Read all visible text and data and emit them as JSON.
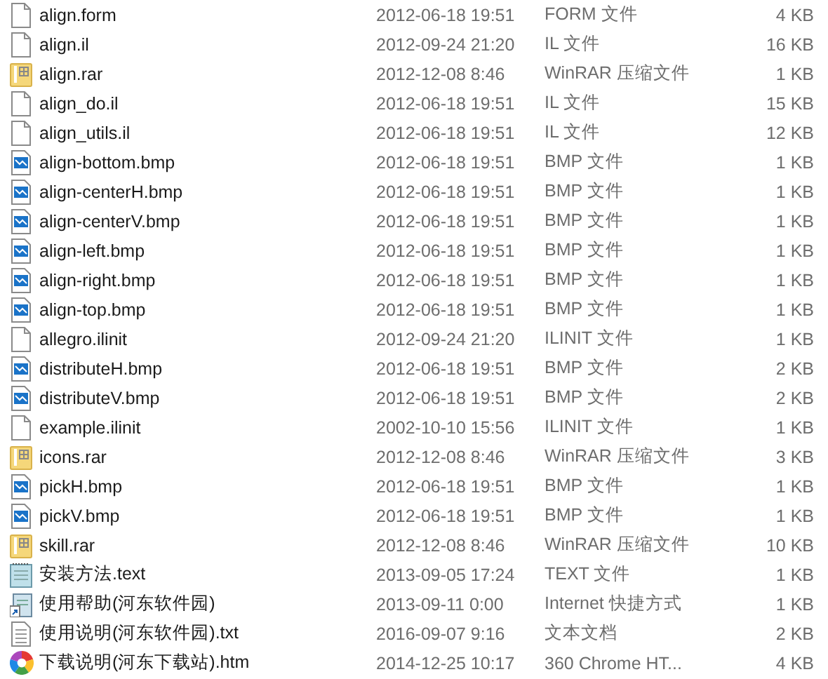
{
  "files": [
    {
      "name": "align.form",
      "kind": "blank",
      "date": "2012-06-18 19:51",
      "type": "FORM 文件",
      "size": "4 KB"
    },
    {
      "name": "align.il",
      "kind": "blank",
      "date": "2012-09-24 21:20",
      "type": "IL 文件",
      "size": "16 KB"
    },
    {
      "name": "align.rar",
      "kind": "rar",
      "date": "2012-12-08 8:46",
      "type": "WinRAR 压缩文件",
      "size": "1 KB"
    },
    {
      "name": "align_do.il",
      "kind": "blank",
      "date": "2012-06-18 19:51",
      "type": "IL 文件",
      "size": "15 KB"
    },
    {
      "name": "align_utils.il",
      "kind": "blank",
      "date": "2012-06-18 19:51",
      "type": "IL 文件",
      "size": "12 KB"
    },
    {
      "name": "align-bottom.bmp",
      "kind": "bmp",
      "date": "2012-06-18 19:51",
      "type": "BMP 文件",
      "size": "1 KB"
    },
    {
      "name": "align-centerH.bmp",
      "kind": "bmp",
      "date": "2012-06-18 19:51",
      "type": "BMP 文件",
      "size": "1 KB"
    },
    {
      "name": "align-centerV.bmp",
      "kind": "bmp",
      "date": "2012-06-18 19:51",
      "type": "BMP 文件",
      "size": "1 KB"
    },
    {
      "name": "align-left.bmp",
      "kind": "bmp",
      "date": "2012-06-18 19:51",
      "type": "BMP 文件",
      "size": "1 KB"
    },
    {
      "name": "align-right.bmp",
      "kind": "bmp",
      "date": "2012-06-18 19:51",
      "type": "BMP 文件",
      "size": "1 KB"
    },
    {
      "name": "align-top.bmp",
      "kind": "bmp",
      "date": "2012-06-18 19:51",
      "type": "BMP 文件",
      "size": "1 KB"
    },
    {
      "name": "allegro.ilinit",
      "kind": "blank",
      "date": "2012-09-24 21:20",
      "type": "ILINIT 文件",
      "size": "1 KB"
    },
    {
      "name": "distributeH.bmp",
      "kind": "bmp",
      "date": "2012-06-18 19:51",
      "type": "BMP 文件",
      "size": "2 KB"
    },
    {
      "name": "distributeV.bmp",
      "kind": "bmp",
      "date": "2012-06-18 19:51",
      "type": "BMP 文件",
      "size": "2 KB"
    },
    {
      "name": "example.ilinit",
      "kind": "blank",
      "date": "2002-10-10 15:56",
      "type": "ILINIT 文件",
      "size": "1 KB"
    },
    {
      "name": "icons.rar",
      "kind": "rar",
      "date": "2012-12-08 8:46",
      "type": "WinRAR 压缩文件",
      "size": "3 KB"
    },
    {
      "name": "pickH.bmp",
      "kind": "bmp",
      "date": "2012-06-18 19:51",
      "type": "BMP 文件",
      "size": "1 KB"
    },
    {
      "name": "pickV.bmp",
      "kind": "bmp",
      "date": "2012-06-18 19:51",
      "type": "BMP 文件",
      "size": "1 KB"
    },
    {
      "name": "skill.rar",
      "kind": "rar",
      "date": "2012-12-08 8:46",
      "type": "WinRAR 压缩文件",
      "size": "10 KB"
    },
    {
      "name": "安装方法.text",
      "kind": "notepad",
      "date": "2013-09-05 17:24",
      "type": "TEXT 文件",
      "size": "1 KB"
    },
    {
      "name": "使用帮助(河东软件园)",
      "kind": "shortcut",
      "date": "2013-09-11 0:00",
      "type": "Internet 快捷方式",
      "size": "1 KB"
    },
    {
      "name": "使用说明(河东软件园).txt",
      "kind": "txt",
      "date": "2016-09-07 9:16",
      "type": "文本文档",
      "size": "2 KB"
    },
    {
      "name": "下载说明(河东下载站).htm",
      "kind": "browser",
      "date": "2014-12-25 10:17",
      "type": "360 Chrome HT...",
      "size": "4 KB"
    }
  ]
}
